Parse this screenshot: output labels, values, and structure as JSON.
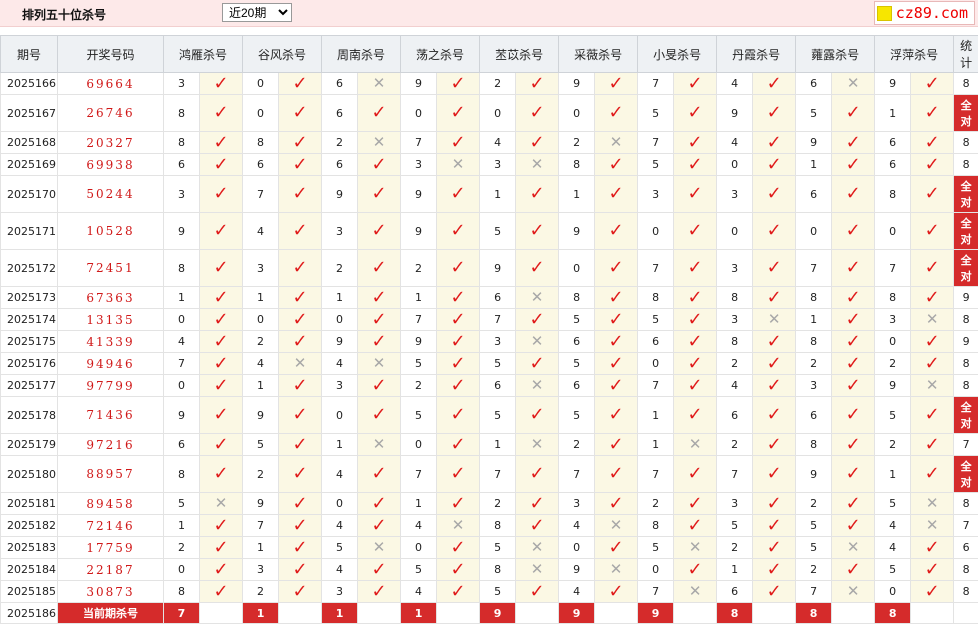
{
  "header": {
    "title": "排列五十位杀号",
    "period_selected": "近20期",
    "brand": "cz89.com"
  },
  "columns": {
    "issue": "期号",
    "winning": "开奖号码",
    "stat": "统计",
    "experts": [
      "鸿雁杀号",
      "谷风杀号",
      "周南杀号",
      "荡之杀号",
      "苤苡杀号",
      "采薇杀号",
      "小旻杀号",
      "丹霞杀号",
      "蕹露杀号",
      "浮萍杀号"
    ]
  },
  "ok_mark": "✓",
  "no_mark": "✕",
  "all_correct": "全对",
  "rows": [
    {
      "issue": "2025166",
      "winning": "69664",
      "vals": [
        "3",
        "0",
        "6",
        "9",
        "2",
        "9",
        "7",
        "4",
        "6",
        "9"
      ],
      "hits": [
        1,
        1,
        0,
        1,
        1,
        1,
        1,
        1,
        0,
        1
      ],
      "stat": "8"
    },
    {
      "issue": "2025167",
      "winning": "26746",
      "vals": [
        "8",
        "0",
        "6",
        "0",
        "0",
        "0",
        "5",
        "9",
        "5",
        "1"
      ],
      "hits": [
        1,
        1,
        1,
        1,
        1,
        1,
        1,
        1,
        1,
        1
      ],
      "stat": "全对"
    },
    {
      "issue": "2025168",
      "winning": "20327",
      "vals": [
        "8",
        "8",
        "2",
        "7",
        "4",
        "2",
        "7",
        "4",
        "9",
        "6"
      ],
      "hits": [
        1,
        1,
        0,
        1,
        1,
        0,
        1,
        1,
        1,
        1
      ],
      "stat": "8"
    },
    {
      "issue": "2025169",
      "winning": "69938",
      "vals": [
        "6",
        "6",
        "6",
        "3",
        "3",
        "8",
        "5",
        "0",
        "1",
        "6"
      ],
      "hits": [
        1,
        1,
        1,
        0,
        0,
        1,
        1,
        1,
        1,
        1
      ],
      "stat": "8"
    },
    {
      "issue": "2025170",
      "winning": "50244",
      "vals": [
        "3",
        "7",
        "9",
        "9",
        "1",
        "1",
        "3",
        "3",
        "6",
        "8"
      ],
      "hits": [
        1,
        1,
        1,
        1,
        1,
        1,
        1,
        1,
        1,
        1
      ],
      "stat": "全对"
    },
    {
      "issue": "2025171",
      "winning": "10528",
      "vals": [
        "9",
        "4",
        "3",
        "9",
        "5",
        "9",
        "0",
        "0",
        "0",
        "0"
      ],
      "hits": [
        1,
        1,
        1,
        1,
        1,
        1,
        1,
        1,
        1,
        1
      ],
      "stat": "全对"
    },
    {
      "issue": "2025172",
      "winning": "72451",
      "vals": [
        "8",
        "3",
        "2",
        "2",
        "9",
        "0",
        "7",
        "3",
        "7",
        "7"
      ],
      "hits": [
        1,
        1,
        1,
        1,
        1,
        1,
        1,
        1,
        1,
        1
      ],
      "stat": "全对"
    },
    {
      "issue": "2025173",
      "winning": "67363",
      "vals": [
        "1",
        "1",
        "1",
        "1",
        "6",
        "8",
        "8",
        "8",
        "8",
        "8"
      ],
      "hits": [
        1,
        1,
        1,
        1,
        0,
        1,
        1,
        1,
        1,
        1
      ],
      "stat": "9"
    },
    {
      "issue": "2025174",
      "winning": "13135",
      "vals": [
        "0",
        "0",
        "0",
        "7",
        "7",
        "5",
        "5",
        "3",
        "1",
        "3"
      ],
      "hits": [
        1,
        1,
        1,
        1,
        1,
        1,
        1,
        0,
        1,
        0
      ],
      "stat": "8"
    },
    {
      "issue": "2025175",
      "winning": "41339",
      "vals": [
        "4",
        "2",
        "9",
        "9",
        "3",
        "6",
        "6",
        "8",
        "8",
        "0"
      ],
      "hits": [
        1,
        1,
        1,
        1,
        0,
        1,
        1,
        1,
        1,
        1
      ],
      "stat": "9"
    },
    {
      "issue": "2025176",
      "winning": "94946",
      "vals": [
        "7",
        "4",
        "4",
        "5",
        "5",
        "5",
        "0",
        "2",
        "2",
        "2"
      ],
      "hits": [
        1,
        0,
        0,
        1,
        1,
        1,
        1,
        1,
        1,
        1
      ],
      "stat": "8"
    },
    {
      "issue": "2025177",
      "winning": "97799",
      "vals": [
        "0",
        "1",
        "3",
        "2",
        "6",
        "6",
        "7",
        "4",
        "3",
        "9"
      ],
      "hits": [
        1,
        1,
        1,
        1,
        0,
        1,
        1,
        1,
        1,
        0
      ],
      "stat": "8"
    },
    {
      "issue": "2025178",
      "winning": "71436",
      "vals": [
        "9",
        "9",
        "0",
        "5",
        "5",
        "5",
        "1",
        "6",
        "6",
        "5"
      ],
      "hits": [
        1,
        1,
        1,
        1,
        1,
        1,
        1,
        1,
        1,
        1
      ],
      "stat": "全对"
    },
    {
      "issue": "2025179",
      "winning": "97216",
      "vals": [
        "6",
        "5",
        "1",
        "0",
        "1",
        "2",
        "1",
        "2",
        "8",
        "2"
      ],
      "hits": [
        1,
        1,
        0,
        1,
        0,
        1,
        0,
        1,
        1,
        1
      ],
      "stat": "7"
    },
    {
      "issue": "2025180",
      "winning": "88957",
      "vals": [
        "8",
        "2",
        "4",
        "7",
        "7",
        "7",
        "7",
        "7",
        "9",
        "1"
      ],
      "hits": [
        1,
        1,
        1,
        1,
        1,
        1,
        1,
        1,
        1,
        1
      ],
      "stat": "全对"
    },
    {
      "issue": "2025181",
      "winning": "89458",
      "vals": [
        "5",
        "9",
        "0",
        "1",
        "2",
        "3",
        "2",
        "3",
        "2",
        "5"
      ],
      "hits": [
        0,
        1,
        1,
        1,
        1,
        1,
        1,
        1,
        1,
        0
      ],
      "stat": "8"
    },
    {
      "issue": "2025182",
      "winning": "72146",
      "vals": [
        "1",
        "7",
        "4",
        "4",
        "8",
        "4",
        "8",
        "5",
        "5",
        "4"
      ],
      "hits": [
        1,
        1,
        1,
        0,
        1,
        0,
        1,
        1,
        1,
        0
      ],
      "stat": "7"
    },
    {
      "issue": "2025183",
      "winning": "17759",
      "vals": [
        "2",
        "1",
        "5",
        "0",
        "5",
        "0",
        "5",
        "2",
        "5",
        "4"
      ],
      "hits": [
        1,
        1,
        0,
        1,
        0,
        1,
        0,
        1,
        0,
        1
      ],
      "stat": "6"
    },
    {
      "issue": "2025184",
      "winning": "22187",
      "vals": [
        "0",
        "3",
        "4",
        "5",
        "8",
        "9",
        "0",
        "1",
        "2",
        "5"
      ],
      "hits": [
        1,
        1,
        1,
        1,
        0,
        0,
        1,
        1,
        1,
        1
      ],
      "stat": "8"
    },
    {
      "issue": "2025185",
      "winning": "30873",
      "vals": [
        "8",
        "2",
        "3",
        "4",
        "5",
        "4",
        "7",
        "6",
        "7",
        "0"
      ],
      "hits": [
        1,
        1,
        1,
        1,
        1,
        1,
        0,
        1,
        0,
        1
      ],
      "stat": "8"
    }
  ],
  "current": {
    "issue": "2025186",
    "label": "当前期杀号",
    "vals": [
      "7",
      "1",
      "1",
      "1",
      "9",
      "9",
      "9",
      "8",
      "8",
      "8"
    ]
  }
}
